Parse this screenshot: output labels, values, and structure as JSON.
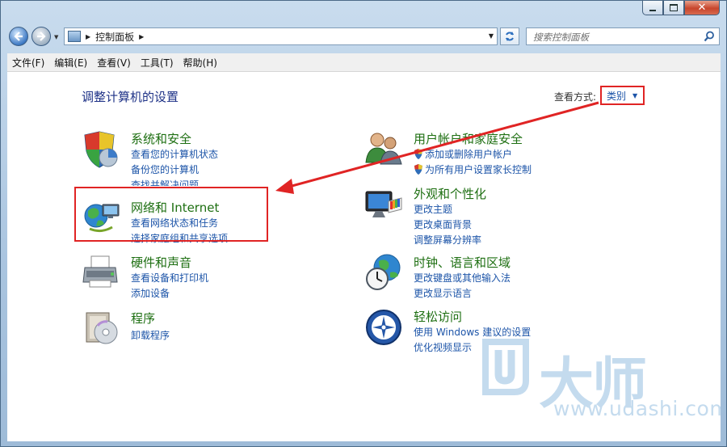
{
  "window": {
    "caption_buttons": [
      "minimize",
      "maximize",
      "close"
    ]
  },
  "navbar": {
    "back_icon": "back-arrow-icon",
    "forward_icon": "forward-arrow-icon",
    "address_breadcrumb": "控制面板",
    "search_placeholder": "搜索控制面板"
  },
  "menubar": {
    "items": [
      "文件(F)",
      "编辑(E)",
      "查看(V)",
      "工具(T)",
      "帮助(H)"
    ]
  },
  "content": {
    "title": "调整计算机的设置",
    "view_by_label": "查看方式:",
    "view_by_value": "类别",
    "categories": [
      {
        "title": "系统和安全",
        "icon": "shield-pie-icon",
        "links": [
          "查看您的计算机状态",
          "备份您的计算机",
          "查找并解决问题"
        ]
      },
      {
        "title": "网络和 Internet",
        "icon": "network-globe-icon",
        "links": [
          "查看网络状态和任务",
          "选择家庭组和共享选项"
        ]
      },
      {
        "title": "硬件和声音",
        "icon": "printer-icon",
        "links": [
          "查看设备和打印机",
          "添加设备"
        ]
      },
      {
        "title": "程序",
        "icon": "programs-disc-icon",
        "links": [
          "卸载程序"
        ]
      },
      {
        "title": "用户帐户和家庭安全",
        "icon": "users-icon",
        "links": [
          "添加或删除用户帐户",
          "为所有用户设置家长控制"
        ]
      },
      {
        "title": "外观和个性化",
        "icon": "monitor-palette-icon",
        "links": [
          "更改主题",
          "更改桌面背景",
          "调整屏幕分辨率"
        ]
      },
      {
        "title": "时钟、语言和区域",
        "icon": "clock-globe-icon",
        "links": [
          "更改键盘或其他输入法",
          "更改显示语言"
        ]
      },
      {
        "title": "轻松访问",
        "icon": "accessibility-icon",
        "links": [
          "使用 Windows 建议的设置",
          "优化视频显示"
        ]
      }
    ]
  },
  "watermark": {
    "brand": "U大师",
    "url": "www.udashi.com"
  },
  "colors": {
    "annotation_red": "#e02424",
    "link_blue": "#1c54a8",
    "category_green": "#1e6f12",
    "title_blue": "#1e3287"
  }
}
